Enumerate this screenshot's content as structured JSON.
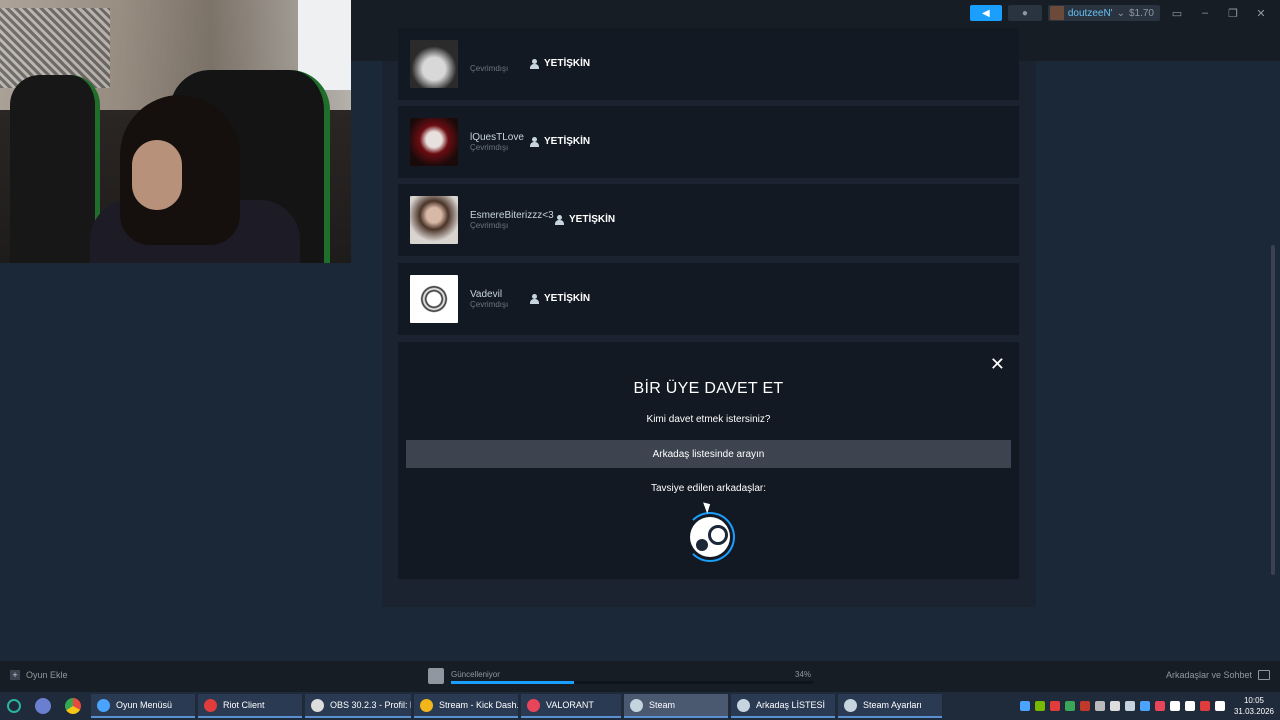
{
  "topbar": {
    "account_name": "doutzeeN'",
    "account_balance": "$1.70"
  },
  "members": [
    {
      "name": "",
      "status": "Çevrimdışı",
      "role": "YETİŞKİN"
    },
    {
      "name": "lQuesTLove",
      "status": "Çevrimdışı",
      "role": "YETİŞKİN"
    },
    {
      "name": "EsmereBiterizzz<3",
      "status": "Çevrimdışı",
      "role": "YETİŞKİN"
    },
    {
      "name": "Vadevil",
      "status": "Çevrimdışı",
      "role": "YETİŞKİN"
    }
  ],
  "invite": {
    "close": "✕",
    "title": "BİR ÜYE DAVET ET",
    "question": "Kimi davet etmek istersiniz?",
    "search_button": "Arkadaş listesinde arayın",
    "suggested_label": "Tavsiye edilen arkadaşlar:"
  },
  "bottombar": {
    "add_game": "Oyun Ekle",
    "update_status": "Güncelleniyor",
    "update_percent": "34%",
    "update_progress": 0.34,
    "friends_chat": "Arkadaşlar ve Sohbet"
  },
  "taskbar": {
    "items": [
      {
        "label": "Oyun Menüsü",
        "color": "#4aa3ff"
      },
      {
        "label": "Riot Client",
        "color": "#e03c3c"
      },
      {
        "label": "OBS 30.2.3 - Profil: l...",
        "color": "#dddddd"
      },
      {
        "label": "Stream - Kick Dash...",
        "color": "#f2b51c"
      },
      {
        "label": "VALORANT",
        "color": "#e8455a"
      },
      {
        "label": "Steam",
        "color": "#c6d4df"
      },
      {
        "label": "Arkadaş LİSTESİ",
        "color": "#c6d4df"
      },
      {
        "label": "Steam Ayarları",
        "color": "#c6d4df"
      }
    ],
    "time": "10:05",
    "date": "31.03.2026"
  },
  "colors": {
    "accent": "#1a9fff",
    "background": "#1b2838",
    "panel": "#131922"
  }
}
